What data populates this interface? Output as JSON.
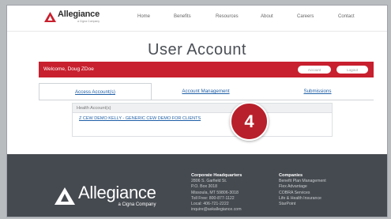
{
  "nav": {
    "brand": "Allegiance",
    "brand_sub": "a Cigna Company",
    "links": [
      "Home",
      "Benefits",
      "Resources",
      "About",
      "Careers",
      "Contact"
    ]
  },
  "page_title": "User Account",
  "account_bar": {
    "welcome": "Welcome, Doug ZDoe",
    "account_btn": "Account",
    "logout_btn": "Logout"
  },
  "tabs": [
    "Access Account(s)",
    "Account Management",
    "Submissions"
  ],
  "accounts_panel": {
    "header": "Health Account(s)",
    "link": "Z CEW DEMO KELLY - GENERIC CEW DEMO FOR CLIENTS"
  },
  "step_badge": "4",
  "footer": {
    "brand": "Allegiance",
    "brand_sub": "a Cigna Company",
    "hq_heading": "Corporate Headquarters",
    "hq_lines": [
      "2806 S. Garfield St.",
      "P.O. Box 3018",
      "Missoula, MT 59806-3018",
      "Toll Free: 800-877-1122",
      "Local: 406-721-2222",
      "inquire@askallegiance.com"
    ],
    "companies_heading": "Companies",
    "companies": [
      "Benefit Plan Management",
      "Flex Advantage",
      "COBRA Services",
      "Life & Health Insurance",
      "StarPoint"
    ]
  },
  "colors": {
    "brand_red": "#c8202e",
    "link_blue": "#1f5fa6",
    "footer_bg": "#454a50"
  }
}
